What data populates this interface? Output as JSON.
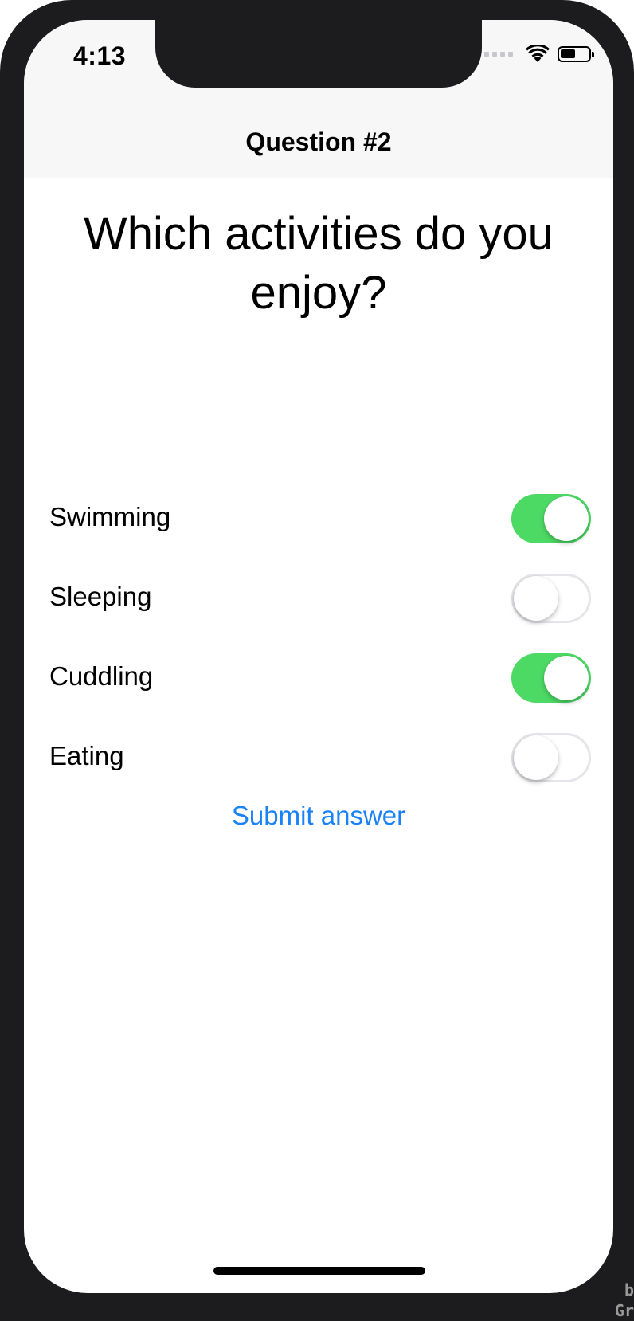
{
  "status_bar": {
    "time": "4:13",
    "icons": [
      "cellular-signal-icon",
      "wifi-icon",
      "battery-icon"
    ]
  },
  "nav": {
    "title": "Question #2"
  },
  "question": {
    "text": "Which activities do you enjoy?"
  },
  "options": [
    {
      "label": "Swimming",
      "enabled": true
    },
    {
      "label": "Sleeping",
      "enabled": false
    },
    {
      "label": "Cuddling",
      "enabled": true
    },
    {
      "label": "Eating",
      "enabled": false
    }
  ],
  "submit": {
    "label": "Submit answer"
  },
  "corner_mark": {
    "line1": "b",
    "line2": "Gr"
  },
  "colors": {
    "toggle_on": "#4cd964",
    "link": "#1a82f7",
    "nav_background": "#f7f7f7"
  }
}
